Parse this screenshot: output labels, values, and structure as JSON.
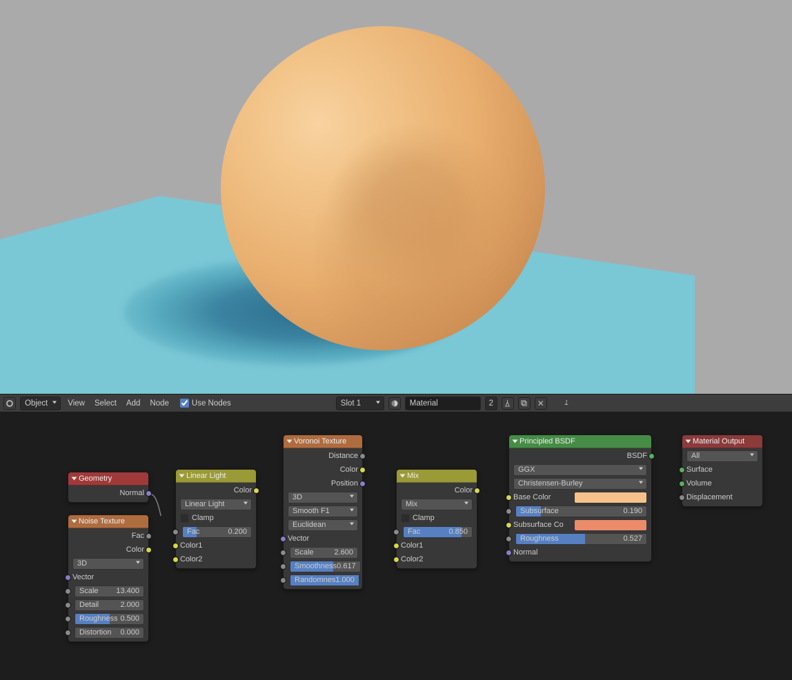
{
  "header": {
    "mode": "Object",
    "menus": [
      "View",
      "Select",
      "Add",
      "Node"
    ],
    "use_nodes": "Use Nodes",
    "slot": "Slot 1",
    "material": "Material",
    "users": "2"
  },
  "nodes": {
    "geometry": {
      "title": "Geometry",
      "out_normal": "Normal"
    },
    "noise": {
      "title": "Noise Texture",
      "out_fac": "Fac",
      "out_color": "Color",
      "dim": "3D",
      "vector": "Vector",
      "scale": {
        "l": "Scale",
        "v": "13.400"
      },
      "detail": {
        "l": "Detail",
        "v": "2.000"
      },
      "rough": {
        "l": "Roughness",
        "v": "0.500"
      },
      "dist": {
        "l": "Distortion",
        "v": "0.000"
      }
    },
    "linear": {
      "title": "Linear Light",
      "out_color": "Color",
      "blend": "Linear Light",
      "clamp": "Clamp",
      "fac": {
        "l": "Fac",
        "v": "0.200"
      },
      "c1": "Color1",
      "c2": "Color2"
    },
    "voronoi": {
      "title": "Voronoi Texture",
      "out_dist": "Distance",
      "out_color": "Color",
      "out_pos": "Position",
      "dim": "3D",
      "feat": "Smooth F1",
      "metric": "Euclidean",
      "vector": "Vector",
      "scale": {
        "l": "Scale",
        "v": "2.600"
      },
      "smooth": {
        "l": "Smoothness",
        "v": "0.617"
      },
      "rand": {
        "l": "Randomnes",
        "v": "1.000"
      }
    },
    "mix": {
      "title": "Mix",
      "out_color": "Color",
      "blend": "Mix",
      "clamp": "Clamp",
      "fac": {
        "l": "Fac",
        "v": "0.850"
      },
      "c1": "Color1",
      "c2": "Color2"
    },
    "bsdf": {
      "title": "Principled BSDF",
      "out": "BSDF",
      "dist": "GGX",
      "sss": "Christensen-Burley",
      "base": "Base Color",
      "sub": {
        "l": "Subsurface",
        "v": "0.190"
      },
      "subco": "Subsurface Co",
      "rough": {
        "l": "Roughness",
        "v": "0.527"
      },
      "normal": "Normal"
    },
    "output": {
      "title": "Material Output",
      "target": "All",
      "surface": "Surface",
      "volume": "Volume",
      "disp": "Displacement"
    }
  }
}
